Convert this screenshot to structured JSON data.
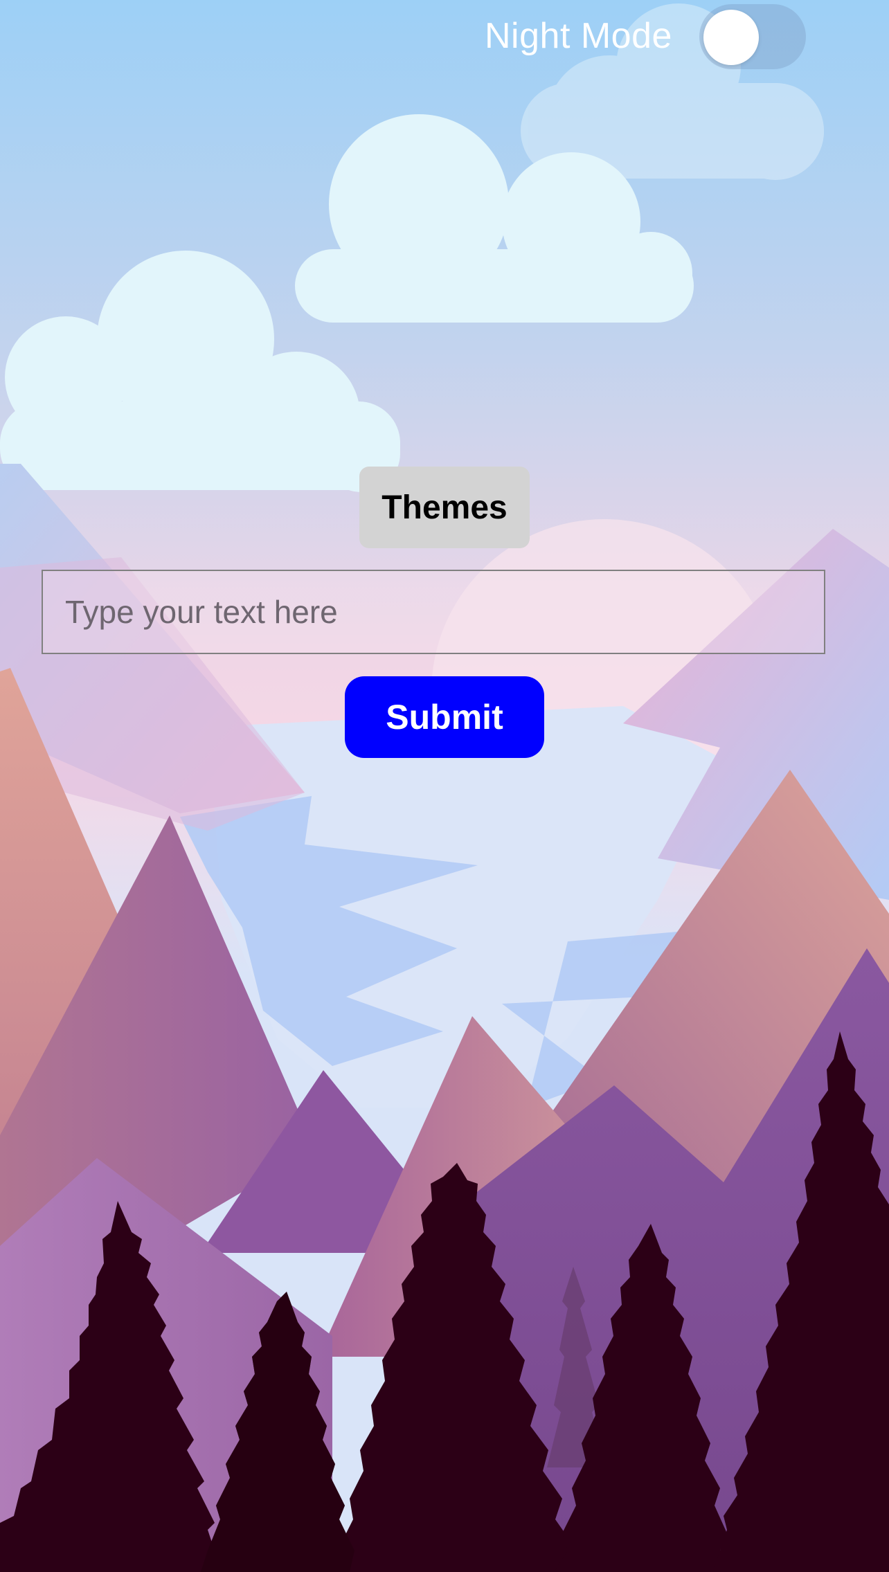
{
  "header": {
    "night_mode_label": "Night Mode",
    "night_mode_on": false
  },
  "themes_button": {
    "label": "Themes"
  },
  "text_input": {
    "placeholder": "Type your text here",
    "value": ""
  },
  "submit_button": {
    "label": "Submit",
    "color": "#0000ff"
  },
  "colors": {
    "sky_top": "#9dd0f6",
    "sky_bottom": "#f3d9e6",
    "cloud": "#e2f5fb",
    "tree": "#2c0016",
    "mountain_purple": "#8a5a9e",
    "mountain_peach": "#d79e97"
  },
  "icons": {
    "toggle": "toggle-switch-icon"
  }
}
